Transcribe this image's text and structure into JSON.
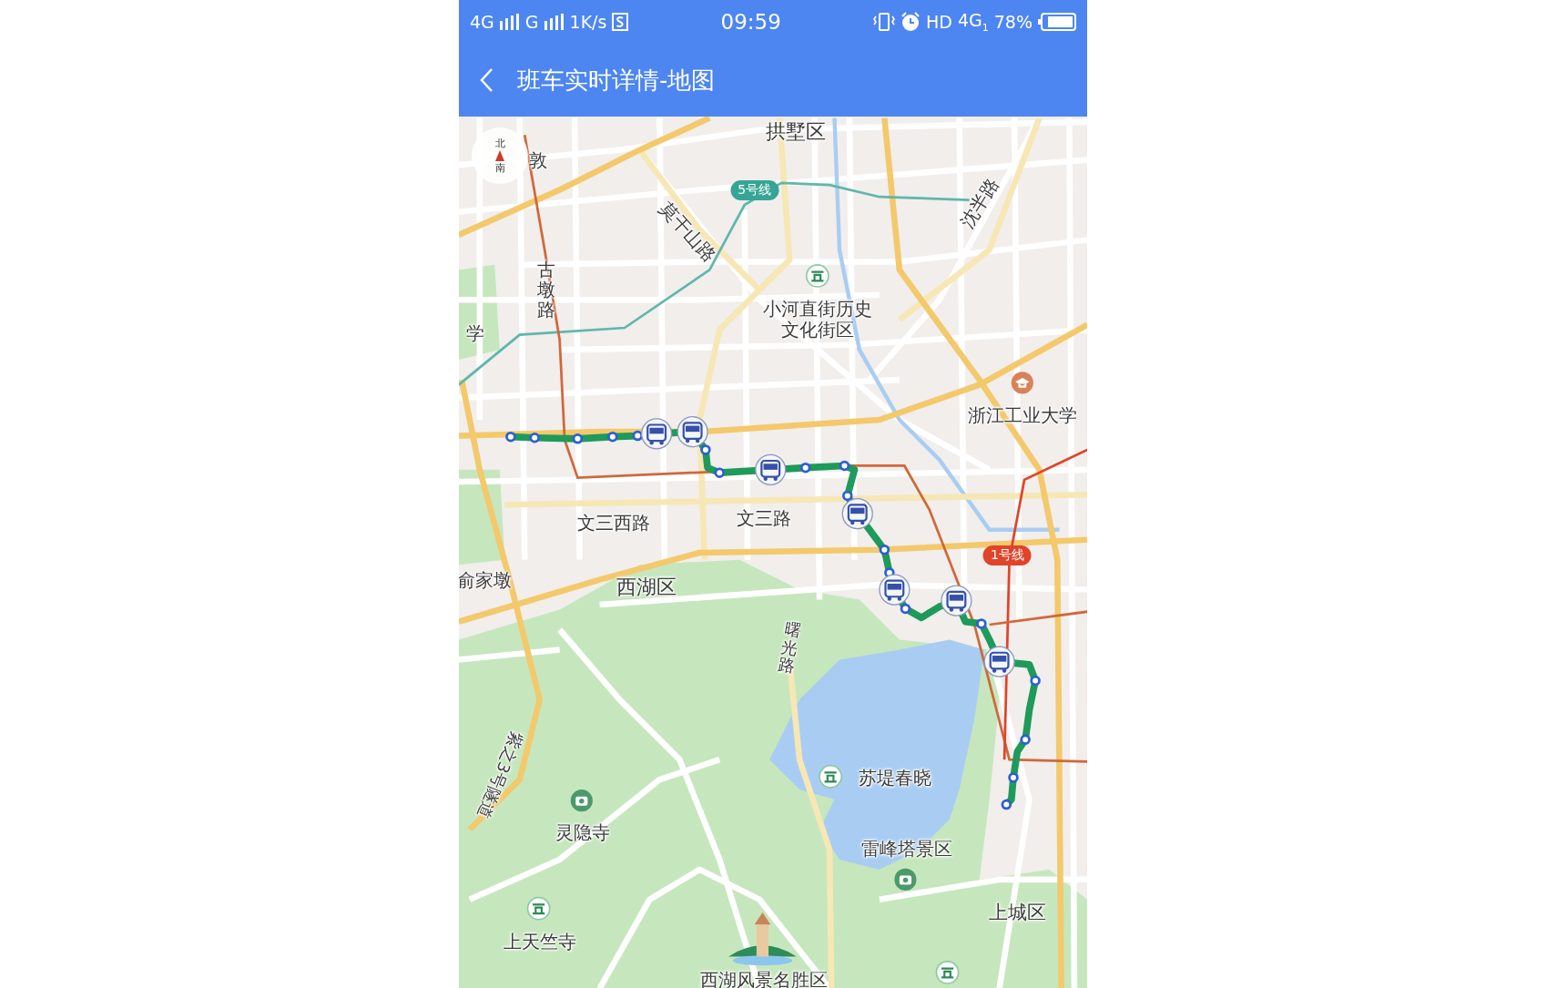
{
  "status_bar": {
    "network_1": "4G",
    "network_2": "G",
    "speed": "1K/s",
    "time": "09:59",
    "hd": "HD",
    "network_3": "4G$_{1}$",
    "battery": "78%"
  },
  "header": {
    "title": "班车实时详情-地图"
  },
  "map": {
    "compass": {
      "north": "北",
      "south": "南"
    },
    "labels": [
      {
        "text": "拱墅区"
      },
      {
        "text": "敦"
      },
      {
        "text": "莫干山路"
      },
      {
        "text": "沈半路"
      },
      {
        "text": "古墩路"
      },
      {
        "text": "学"
      },
      {
        "text": "小河直街历史文化街区"
      },
      {
        "text": "浙江工业大学"
      },
      {
        "text": "文三西路"
      },
      {
        "text": "文三路"
      },
      {
        "text": "俞家墩"
      },
      {
        "text": "西湖区"
      },
      {
        "text": "曙光路"
      },
      {
        "text": "紫之3号隧道"
      },
      {
        "text": "苏堤春晓"
      },
      {
        "text": "灵隐寺"
      },
      {
        "text": "雷峰塔景区"
      },
      {
        "text": "上城区"
      },
      {
        "text": "上天竺寺"
      },
      {
        "text": "西湖风景名胜区"
      }
    ],
    "badges": [
      {
        "text": "5号线",
        "color": "#36a596"
      },
      {
        "text": "1号线",
        "color": "#e0442a"
      }
    ]
  }
}
